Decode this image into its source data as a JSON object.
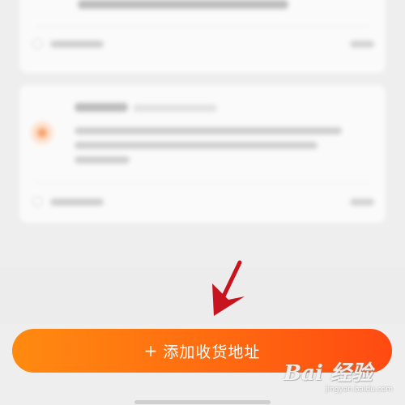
{
  "add_address_button": {
    "icon": "plus-icon",
    "icon_glyph": "+",
    "label": "添加收货地址"
  },
  "watermark": {
    "logo_text": "Bai 经验",
    "url": "jingyan.baidu.com"
  },
  "colors": {
    "button_gradient_start": "#ff8a10",
    "button_gradient_end": "#ff4a12",
    "annotation_arrow": "#c8141e",
    "background": "#eeeeee"
  }
}
